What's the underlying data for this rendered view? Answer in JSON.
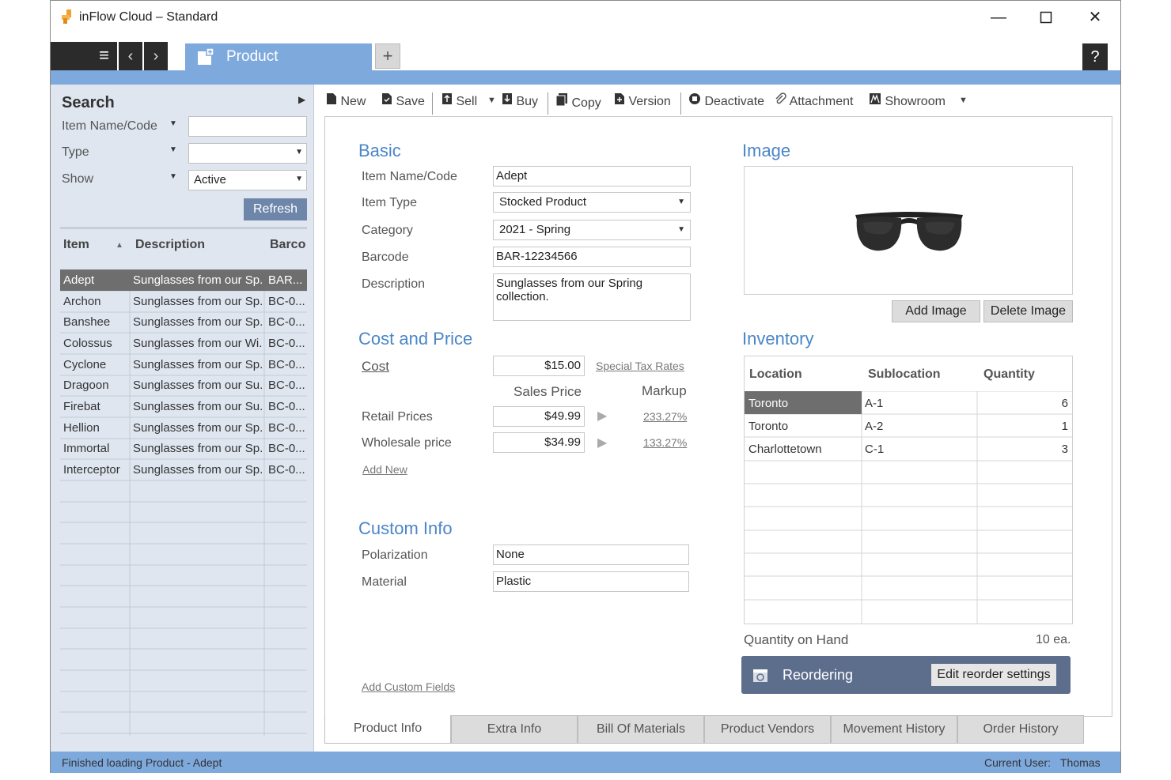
{
  "window": {
    "title": "inFlow Cloud – Standard"
  },
  "tabs": {
    "active": "Product",
    "add": "+",
    "help": "?"
  },
  "search": {
    "title": "Search",
    "filters": [
      {
        "label": "Item Name/Code",
        "value": ""
      },
      {
        "label": "Type",
        "value": ""
      },
      {
        "label": "Show",
        "value": "Active"
      }
    ],
    "refresh": "Refresh"
  },
  "list": {
    "columns": [
      "Item",
      "Description",
      "Barco"
    ],
    "rows": [
      {
        "item": "Adept",
        "desc": "Sunglasses from our Sp...",
        "barcode": "BAR..."
      },
      {
        "item": "Archon",
        "desc": "Sunglasses from our Sp...",
        "barcode": "BC-0..."
      },
      {
        "item": "Banshee",
        "desc": "Sunglasses from our Sp...",
        "barcode": "BC-0..."
      },
      {
        "item": "Colossus",
        "desc": "Sunglasses from our Wi...",
        "barcode": "BC-0..."
      },
      {
        "item": "Cyclone",
        "desc": "Sunglasses from our Sp...",
        "barcode": "BC-0..."
      },
      {
        "item": "Dragoon",
        "desc": "Sunglasses from our Su...",
        "barcode": "BC-0..."
      },
      {
        "item": "Firebat",
        "desc": "Sunglasses from our Su...",
        "barcode": "BC-0..."
      },
      {
        "item": "Hellion",
        "desc": "Sunglasses from our Sp...",
        "barcode": "BC-0..."
      },
      {
        "item": "Immortal",
        "desc": "Sunglasses from our Sp...",
        "barcode": "BC-0..."
      },
      {
        "item": "Interceptor",
        "desc": "Sunglasses from our Sp...",
        "barcode": "BC-0..."
      }
    ]
  },
  "toolbar": {
    "new": "New",
    "save": "Save",
    "sell": "Sell",
    "buy": "Buy",
    "copy": "Copy",
    "version": "Version",
    "deactivate": "Deactivate",
    "attachment": "Attachment",
    "showroom": "Showroom"
  },
  "basic": {
    "title": "Basic",
    "item_name_label": "Item Name/Code",
    "item_name": "Adept",
    "item_type_label": "Item Type",
    "item_type": "Stocked Product",
    "category_label": "Category",
    "category": "2021 - Spring",
    "barcode_label": "Barcode",
    "barcode": "BAR-12234566",
    "description_label": "Description",
    "description": "Sunglasses from our Spring collection."
  },
  "cost": {
    "title": "Cost and Price",
    "cost_label": "Cost",
    "cost": "$15.00",
    "special_tax": "Special Tax Rates",
    "sales_price_head": "Sales Price",
    "markup_head": "Markup",
    "retail_label": "Retail Prices",
    "retail": "$49.99",
    "retail_markup": "233.27%",
    "wholesale_label": "Wholesale price",
    "wholesale": "$34.99",
    "wholesale_markup": "133.27%",
    "add_new": "Add New"
  },
  "custom": {
    "title": "Custom Info",
    "polarization_label": "Polarization",
    "polarization": "None",
    "material_label": "Material",
    "material": "Plastic",
    "add_custom": "Add Custom Fields"
  },
  "image": {
    "title": "Image",
    "add": "Add Image",
    "delete": "Delete Image"
  },
  "inventory": {
    "title": "Inventory",
    "columns": [
      "Location",
      "Sublocation",
      "Quantity"
    ],
    "rows": [
      {
        "location": "Toronto",
        "sub": "A-1",
        "qty": "6"
      },
      {
        "location": "Toronto",
        "sub": "A-2",
        "qty": "1"
      },
      {
        "location": "Charlottetown",
        "sub": "C-1",
        "qty": "3"
      }
    ],
    "qoh_label": "Quantity on Hand",
    "qoh": "10 ea."
  },
  "reorder": {
    "label": "Reordering",
    "button": "Edit reorder settings"
  },
  "bottom_tabs": [
    "Product Info",
    "Extra Info",
    "Bill Of Materials",
    "Product Vendors",
    "Movement History",
    "Order History"
  ],
  "status": {
    "message": "Finished loading Product - Adept",
    "user_label": "Current User:",
    "user": "Thomas"
  }
}
